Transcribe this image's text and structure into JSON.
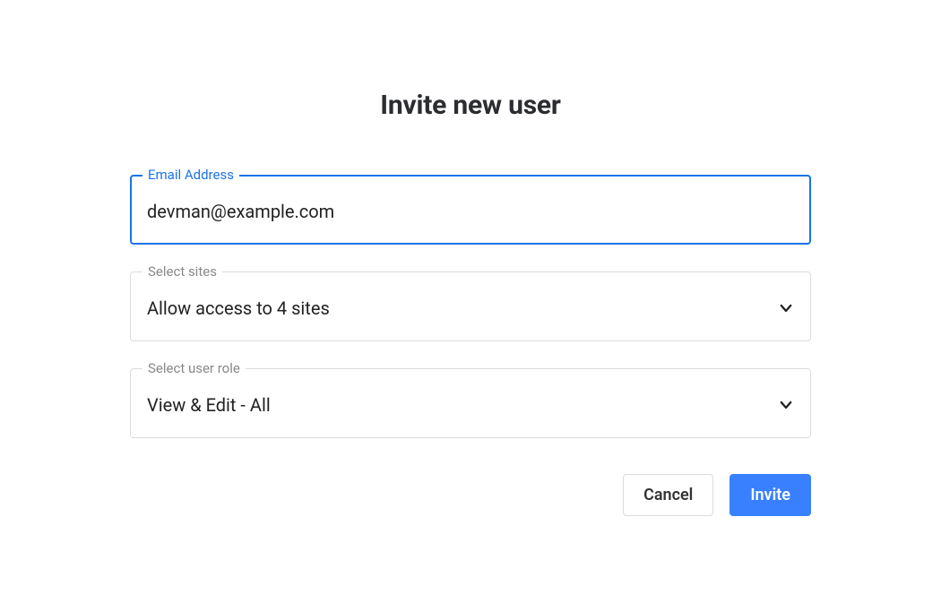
{
  "dialog": {
    "title": "Invite new user",
    "email": {
      "label": "Email Address",
      "value": "devman@example.com"
    },
    "sites": {
      "label": "Select sites",
      "value": "Allow access to 4 sites"
    },
    "role": {
      "label": "Select user role",
      "value": "View & Edit - All"
    },
    "actions": {
      "cancel": "Cancel",
      "invite": "Invite"
    }
  }
}
